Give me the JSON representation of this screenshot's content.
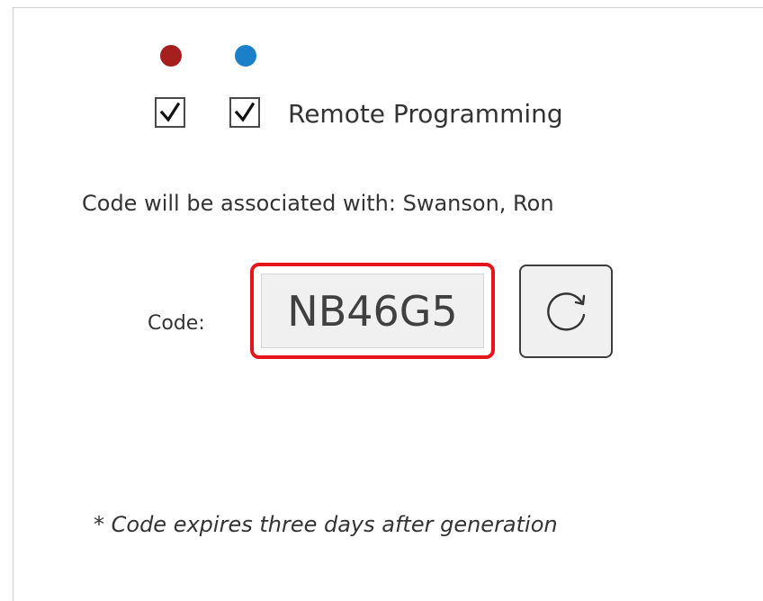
{
  "indicators": {
    "red_dot_color": "#a51f1f",
    "blue_dot_color": "#1b7fc9"
  },
  "checkboxes": {
    "first_checked": true,
    "second_checked": true,
    "label": "Remote Programming"
  },
  "association": {
    "text": "Code will be associated with: Swanson, Ron"
  },
  "code": {
    "label": "Code:",
    "value": "NB46G5",
    "highlight_color": "#e8141c"
  },
  "refresh": {
    "icon": "refresh-icon"
  },
  "footer": {
    "note": "* Code expires three days after generation"
  }
}
